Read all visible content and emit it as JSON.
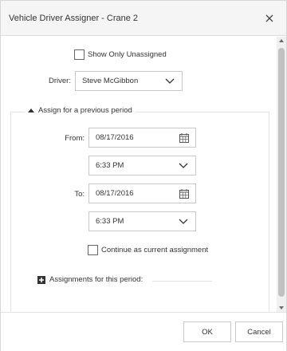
{
  "dialog": {
    "title": "Vehicle Driver Assigner - Crane 2"
  },
  "filters": {
    "show_only_unassigned_label": "Show Only Unassigned",
    "show_only_unassigned_checked": false
  },
  "driver": {
    "label": "Driver:",
    "value": "Steve McGibbon"
  },
  "period_section": {
    "legend": "Assign for a previous period",
    "from_label": "From:",
    "from_date": "08/17/2016",
    "from_time": "6:33 PM",
    "to_label": "To:",
    "to_date": "08/17/2016",
    "to_time": "6:33 PM",
    "continue_label": "Continue as current assignment",
    "continue_checked": false,
    "assignments_label": "Assignments for this period:"
  },
  "footer": {
    "ok_label": "OK",
    "cancel_label": "Cancel"
  },
  "icons": [
    "close-icon",
    "chevron-down-icon",
    "calendar-icon",
    "triangle-up-icon",
    "plus-icon"
  ],
  "colors": {
    "titlebar_bg": "#f5f5f5",
    "border": "#c8c8c8",
    "text": "#333333"
  }
}
